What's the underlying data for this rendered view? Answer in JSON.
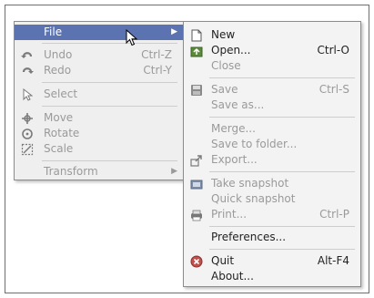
{
  "main_menu": {
    "file": {
      "label": "File",
      "icon": "chevron-right-icon"
    },
    "undo": {
      "label": "Undo",
      "shortcut": "Ctrl-Z",
      "icon": "undo-icon"
    },
    "redo": {
      "label": "Redo",
      "shortcut": "Ctrl-Y",
      "icon": "redo-icon"
    },
    "select": {
      "label": "Select",
      "icon": "pointer-icon"
    },
    "move": {
      "label": "Move",
      "icon": "move-icon"
    },
    "rotate": {
      "label": "Rotate",
      "icon": "rotate-icon"
    },
    "scale": {
      "label": "Scale",
      "icon": "scale-icon"
    },
    "transform": {
      "label": "Transform",
      "icon": "chevron-right-icon"
    }
  },
  "file_menu": {
    "new": {
      "label": "New",
      "icon": "new-document-icon"
    },
    "open": {
      "label": "Open...",
      "shortcut": "Ctrl-O",
      "icon": "open-icon"
    },
    "close": {
      "label": "Close"
    },
    "save": {
      "label": "Save",
      "shortcut": "Ctrl-S",
      "icon": "save-icon"
    },
    "save_as": {
      "label": "Save as..."
    },
    "merge": {
      "label": "Merge..."
    },
    "save_to_folder": {
      "label": "Save to folder..."
    },
    "export": {
      "label": "Export...",
      "icon": "export-icon"
    },
    "take_snapshot": {
      "label": "Take snapshot",
      "icon": "snapshot-icon"
    },
    "quick_snapshot": {
      "label": "Quick snapshot"
    },
    "print": {
      "label": "Print...",
      "shortcut": "Ctrl-P",
      "icon": "print-icon"
    },
    "preferences": {
      "label": "Preferences..."
    },
    "quit": {
      "label": "Quit",
      "shortcut": "Alt-F4",
      "icon": "quit-icon"
    },
    "about": {
      "label": "About..."
    }
  },
  "colors": {
    "highlight": "#5b73b0",
    "disabled": "#9a9a9a",
    "menu_bg": "#efefef"
  }
}
